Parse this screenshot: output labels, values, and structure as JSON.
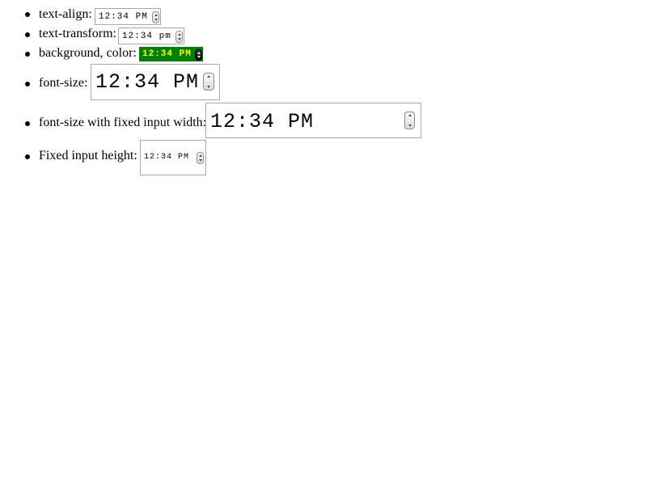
{
  "items": [
    {
      "label": "text-align:",
      "value": "12:34 PM"
    },
    {
      "label": "text-transform:",
      "value": "12:34 pm"
    },
    {
      "label": "background, color:",
      "value": "12:34 PM",
      "bg": "#008000",
      "fg": "#ffff00"
    },
    {
      "label": "font-size:",
      "value": "12:34 PM"
    },
    {
      "label": "font-size with fixed input width:",
      "value": "12:34 PM"
    },
    {
      "label": "Fixed input height:",
      "value": "12:34 PM"
    }
  ],
  "icons": {
    "spinner": "up-down-arrows-icon"
  }
}
